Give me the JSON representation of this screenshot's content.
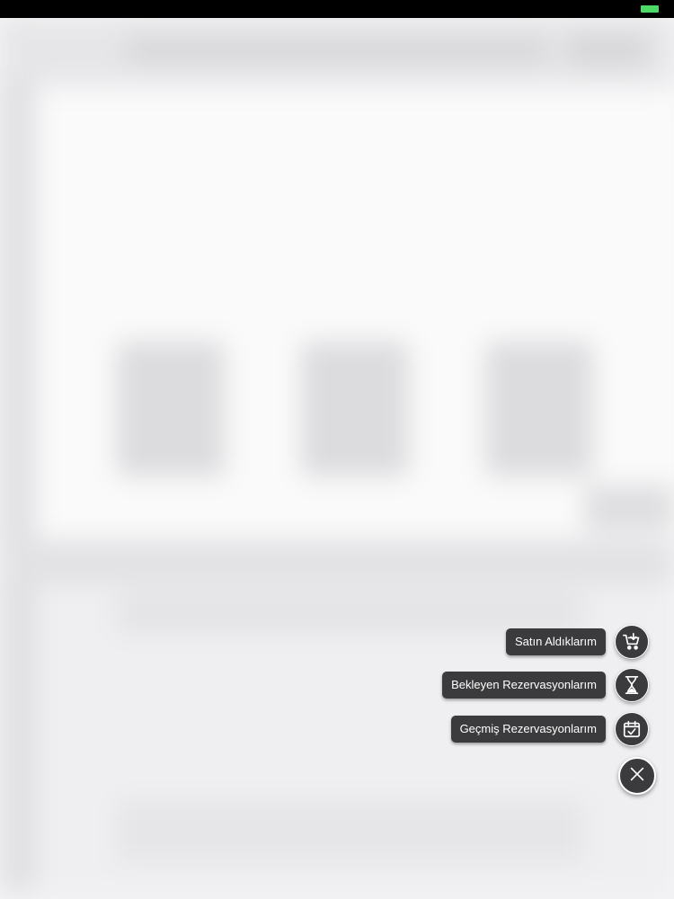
{
  "status_bar": {
    "battery_color": "#4cd964"
  },
  "fab_menu": {
    "items": [
      {
        "label": "Satın Aldıklarım",
        "icon": "cart-icon"
      },
      {
        "label": "Bekleyen Rezervasyonlarım",
        "icon": "hourglass-icon"
      },
      {
        "label": "Geçmiş Rezervasyonlarım",
        "icon": "calendar-check-icon"
      }
    ],
    "close_icon": "close-icon",
    "button_color": "#3b3b3d"
  }
}
